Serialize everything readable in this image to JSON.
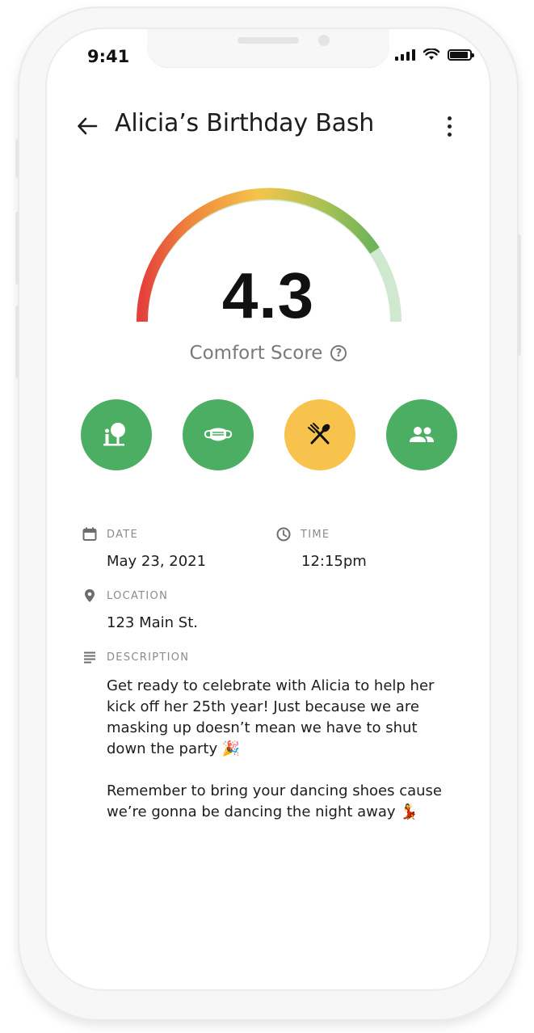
{
  "status_bar": {
    "time": "9:41"
  },
  "header": {
    "title": "Alicia’s Birthday Bash"
  },
  "comfort": {
    "score": "4.3",
    "label": "Comfort Score",
    "help_glyph": "?"
  },
  "indicators": [
    {
      "name": "outdoor-indicator",
      "icon": "outdoor-tree-person-icon",
      "color": "#4cae63"
    },
    {
      "name": "mask-indicator",
      "icon": "face-mask-icon",
      "color": "#4cae63"
    },
    {
      "name": "food-indicator",
      "icon": "fork-spoon-crossed-icon",
      "color": "#f7c34d"
    },
    {
      "name": "group-size-indicator",
      "icon": "people-icon",
      "color": "#4cae63"
    }
  ],
  "details": {
    "date_label": "DATE",
    "date_value": "May 23, 2021",
    "time_label": "TIME",
    "time_value": "12:15pm",
    "location_label": "LOCATION",
    "location_value": "123 Main St.",
    "description_label": "DESCRIPTION",
    "description_p1": "Get ready to celebrate with Alicia to help her kick off her 25th year! Just because we are masking up doesn’t mean we have to shut down the party 🎉",
    "description_p2": "Remember to bring your dancing shoes cause we’re gonna be dancing the night away 💃"
  },
  "colors": {
    "green": "#4cae63",
    "yellow": "#f7c34d",
    "gauge_red": "#e5403b",
    "gauge_orange": "#ef8a3c",
    "gauge_yellow": "#f6c44a",
    "gauge_green": "#86bd58",
    "gauge_light": "#cfe8cf"
  }
}
